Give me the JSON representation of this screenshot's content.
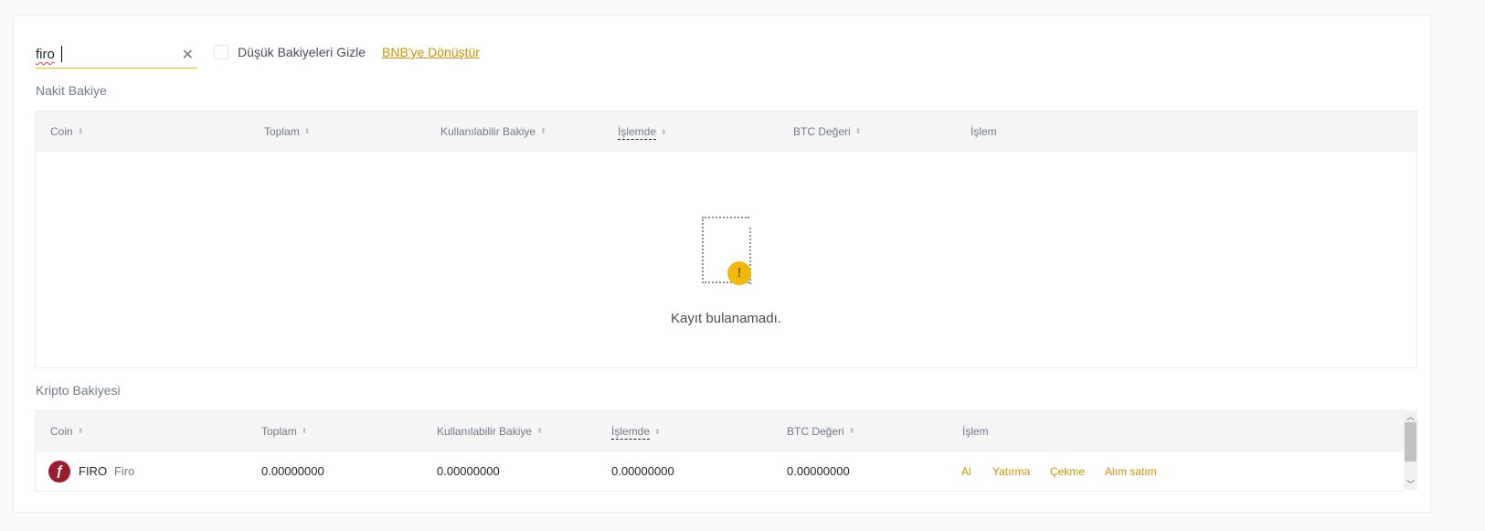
{
  "search": {
    "value": "firo"
  },
  "hide_small": {
    "label": "Düşük Bakiyeleri Gizle",
    "checked": false
  },
  "convert_link": "BNB'ye Dönüştür",
  "cash": {
    "title": "Nakit Bakiye",
    "columns": [
      "Coin",
      "Toplam",
      "Kullanılabilir Bakiye",
      "İşlemde",
      "BTC Değeri",
      "İşlem"
    ],
    "empty_text": "Kayıt bulanamadı."
  },
  "crypto": {
    "title": "Kripto Bakiyesi",
    "columns": [
      "Coin",
      "Toplam",
      "Kullanılabilir Bakiye",
      "İşlemde",
      "BTC Değeri",
      "İşlem"
    ],
    "rows": [
      {
        "symbol": "FIRO",
        "name": "Firo",
        "total": "0.00000000",
        "available": "0.00000000",
        "in_order": "0.00000000",
        "btc_value": "0.00000000",
        "actions": [
          "Al",
          "Yatırma",
          "Çekme",
          "Alım satım"
        ]
      }
    ]
  },
  "colors": {
    "accent": "#f0b90b",
    "link": "#c99400",
    "firo": "#9b1c2e"
  }
}
